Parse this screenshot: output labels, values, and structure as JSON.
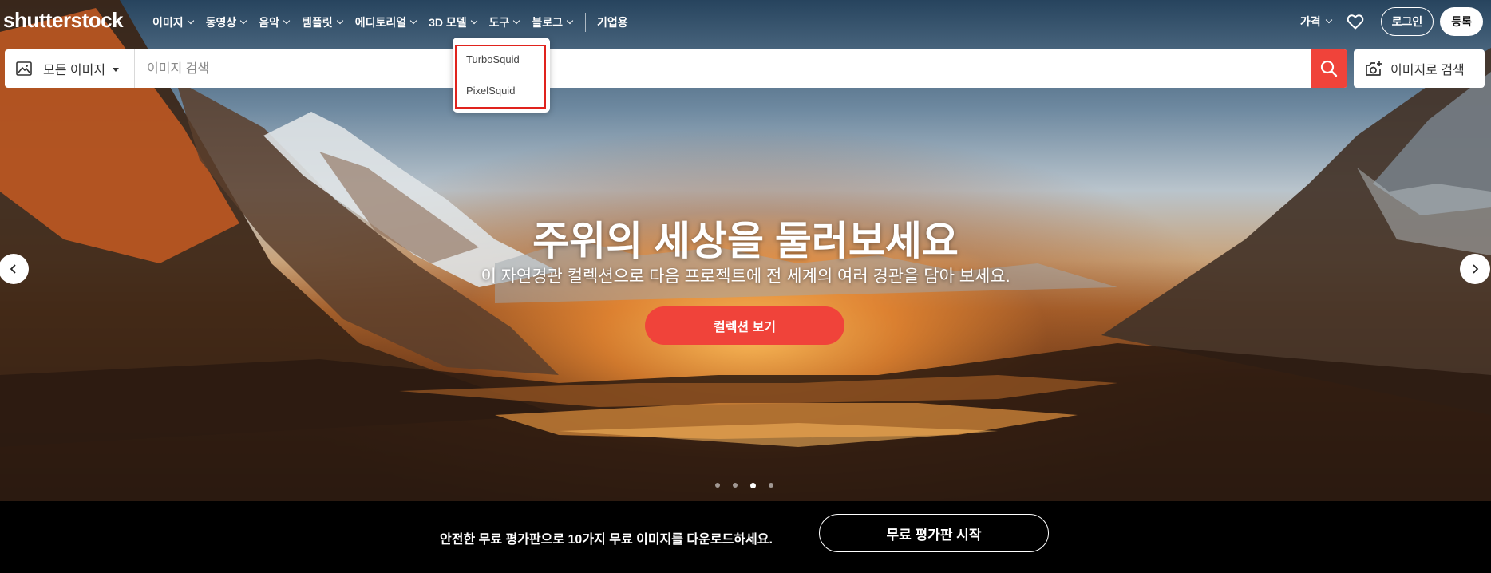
{
  "brand": {
    "logo_text": "shutterstock"
  },
  "nav": {
    "items": [
      {
        "label": "이미지"
      },
      {
        "label": "동영상"
      },
      {
        "label": "음악"
      },
      {
        "label": "템플릿"
      },
      {
        "label": "에디토리얼"
      },
      {
        "label": "3D 모델"
      },
      {
        "label": "도구"
      },
      {
        "label": "블로그"
      }
    ],
    "business_label": "기업용",
    "pricing_label": "가격",
    "login_label": "로그인",
    "signup_label": "등록"
  },
  "search": {
    "type_label": "모든 이미지",
    "placeholder": "이미지 검색",
    "image_search_label": "이미지로 검색"
  },
  "dropdown_3d": {
    "items": [
      {
        "label": "TurboSquid"
      },
      {
        "label": "PixelSquid"
      }
    ]
  },
  "hero": {
    "title": "주위의 세상을 둘러보세요",
    "subtitle": "이 자연경관 컬렉션으로 다음 프로젝트에 전 세계의 여러 경관을 담아 보세요.",
    "cta_label": "컬렉션 보기",
    "carousel_slides": 4,
    "carousel_active_index": 3
  },
  "promo": {
    "text": "안전한 무료 평가판으로 10가지 무료 이미지를 다운로드하세요.",
    "button_label": "무료 평가판 시작"
  },
  "colors": {
    "accent": "#f0433a",
    "highlight_box": "#e0231d"
  }
}
